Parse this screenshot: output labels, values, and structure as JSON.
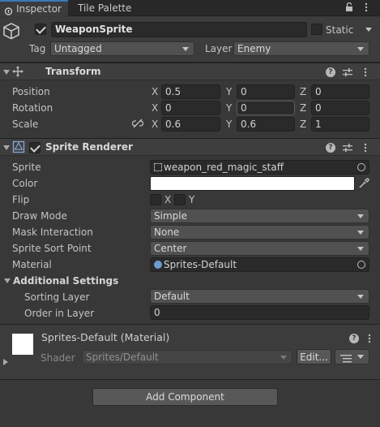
{
  "tabs": [
    {
      "label": "Inspector",
      "active": true
    },
    {
      "label": "Tile Palette",
      "active": false
    }
  ],
  "gameobject": {
    "name": "WeaponSprite",
    "active": true,
    "static_label": "Static",
    "static_checked": false,
    "tag_label": "Tag",
    "tag_value": "Untagged",
    "layer_label": "Layer",
    "layer_value": "Enemy"
  },
  "transform": {
    "title": "Transform",
    "rows": [
      {
        "label": "Position",
        "x": "0.5",
        "y": "0",
        "z": "0"
      },
      {
        "label": "Rotation",
        "x": "0",
        "y": "0",
        "z": "0"
      },
      {
        "label": "Scale",
        "x": "0.6",
        "y": "0.6",
        "z": "1"
      }
    ],
    "axis": {
      "x": "X",
      "y": "Y",
      "z": "Z"
    }
  },
  "sprite_renderer": {
    "title": "Sprite Renderer",
    "enabled": true,
    "sprite_label": "Sprite",
    "sprite_value": "weapon_red_magic_staff",
    "color_label": "Color",
    "color_value": "#ffffff",
    "flip_label": "Flip",
    "flip_x": "X",
    "flip_y": "Y",
    "draw_mode_label": "Draw Mode",
    "draw_mode_value": "Simple",
    "mask_label": "Mask Interaction",
    "mask_value": "None",
    "sort_point_label": "Sprite Sort Point",
    "sort_point_value": "Center",
    "material_label": "Material",
    "material_value": "Sprites-Default",
    "additional_label": "Additional Settings",
    "sorting_layer_label": "Sorting Layer",
    "sorting_layer_value": "Default",
    "order_label": "Order in Layer",
    "order_value": "0"
  },
  "material": {
    "title": "Sprites-Default (Material)",
    "shader_label": "Shader",
    "shader_value": "Sprites/Default",
    "edit_label": "Edit..."
  },
  "add_component_label": "Add Component",
  "colors": {
    "background": "#383838",
    "header": "#3c3c3c",
    "field": "#2a2a2a",
    "accent": "#3a79bb"
  }
}
